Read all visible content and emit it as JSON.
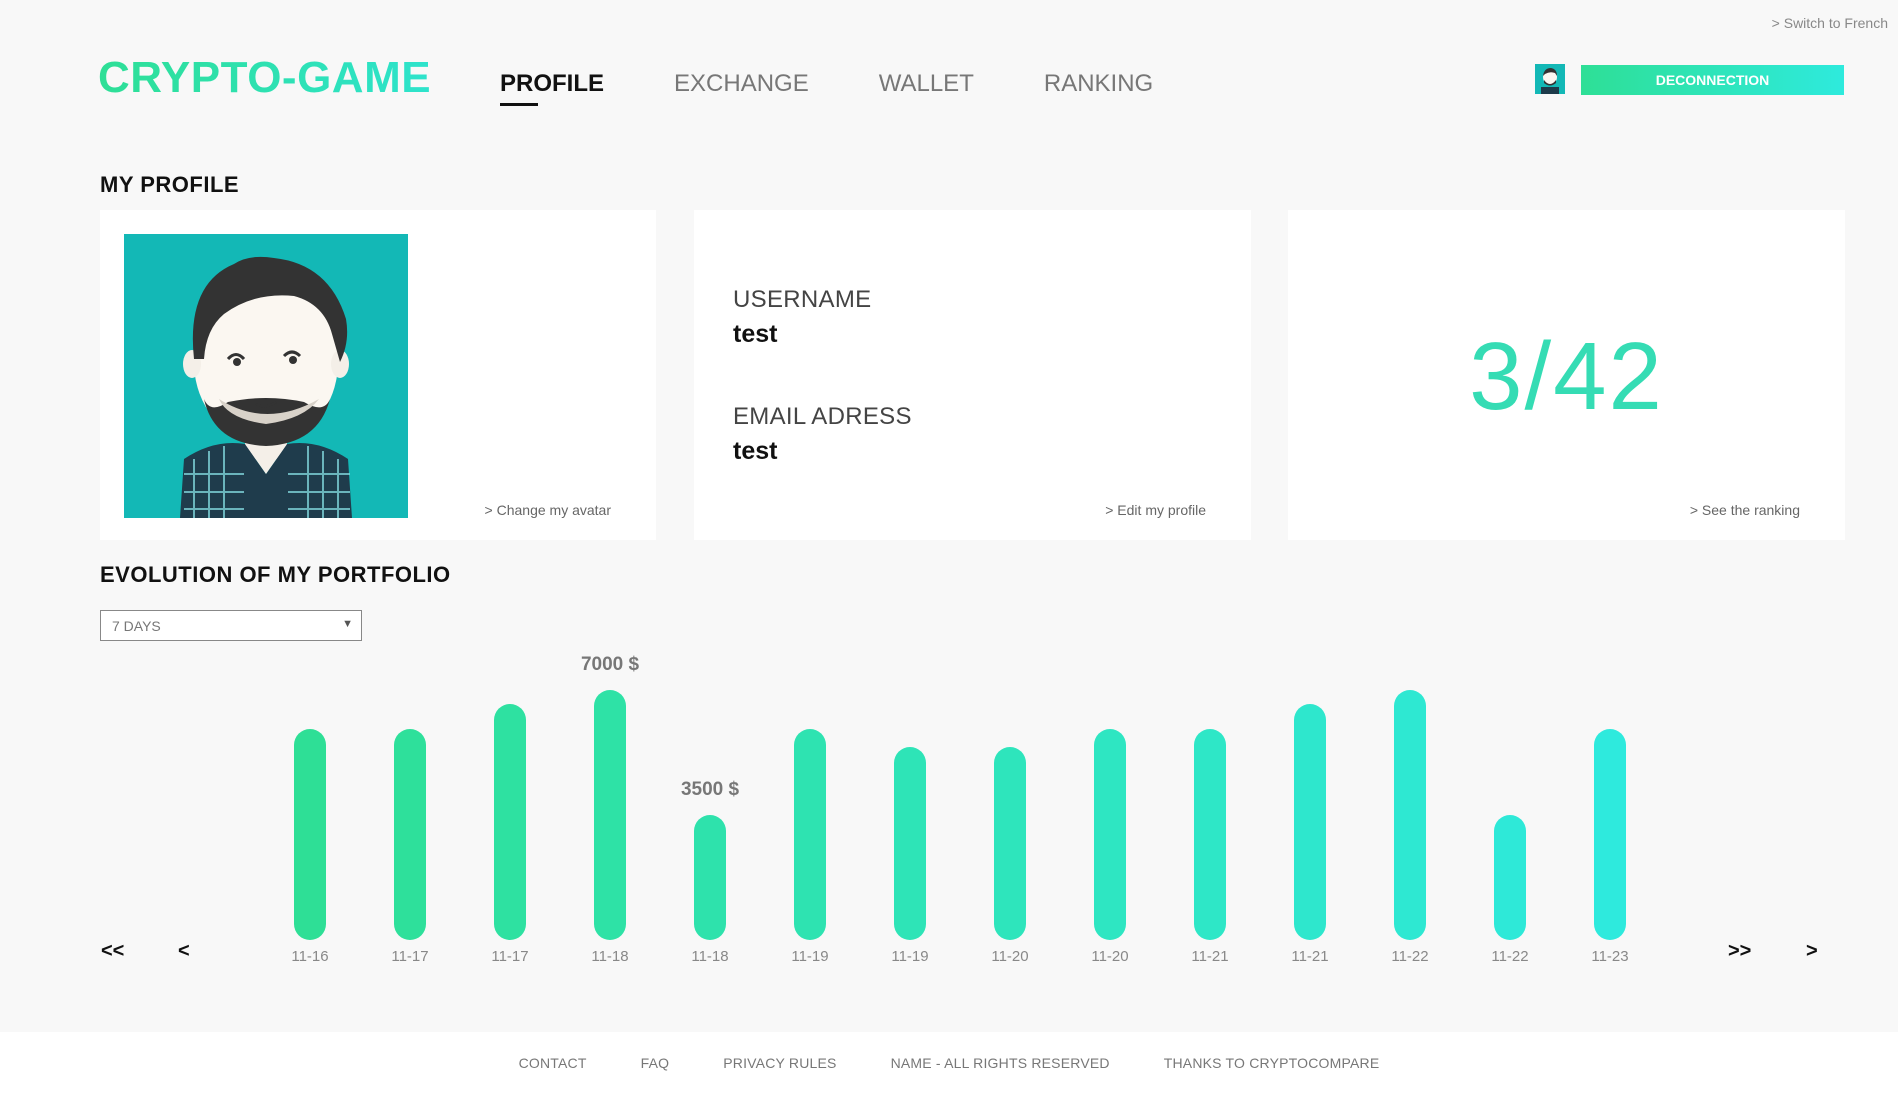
{
  "header": {
    "lang_switch": "> Switch to French",
    "logo": "CRYPTO-GAME",
    "nav": [
      {
        "label": "PROFILE",
        "active": true
      },
      {
        "label": "EXCHANGE",
        "active": false
      },
      {
        "label": "WALLET",
        "active": false
      },
      {
        "label": "RANKING",
        "active": false
      }
    ],
    "deconnection_label": "DECONNECTION"
  },
  "profile": {
    "title": "MY PROFILE",
    "change_avatar": "> Change my avatar",
    "username_label": "USERNAME",
    "username_value": "test",
    "email_label": "EMAIL ADRESS",
    "email_value": "test",
    "edit_profile": "> Edit my profile",
    "rank": "3/42",
    "see_ranking": "> See the ranking"
  },
  "portfolio": {
    "title": "EVOLUTION OF MY PORTFOLIO",
    "period_selected": "7 DAYS",
    "prev_all": "<<",
    "prev": "<",
    "next_all": ">>",
    "next": ">"
  },
  "chart_data": {
    "type": "bar",
    "title": "",
    "xlabel": "",
    "ylabel": "",
    "ylim": [
      0,
      7000
    ],
    "categories": [
      "11-16",
      "11-17",
      "11-17",
      "11-18",
      "11-18",
      "11-19",
      "11-19",
      "11-20",
      "11-20",
      "11-21",
      "11-21",
      "11-22",
      "11-22",
      "11-23"
    ],
    "values": [
      5900,
      5900,
      6600,
      7000,
      3500,
      5900,
      5400,
      5400,
      5900,
      5900,
      6600,
      7000,
      3500,
      5900
    ],
    "labeled": [
      "",
      "",
      "",
      "7000 $",
      "3500 $",
      "",
      "",
      "",
      "",
      "",
      "",
      "",
      "",
      ""
    ],
    "colors": {
      "start": "#2edf96",
      "end": "#2eeadd"
    }
  },
  "footer": {
    "links": [
      "CONTACT",
      "FAQ",
      "PRIVACY RULES",
      "NAME - ALL RIGHTS RESERVED",
      "THANKS TO CRYPTOCOMPARE"
    ]
  }
}
